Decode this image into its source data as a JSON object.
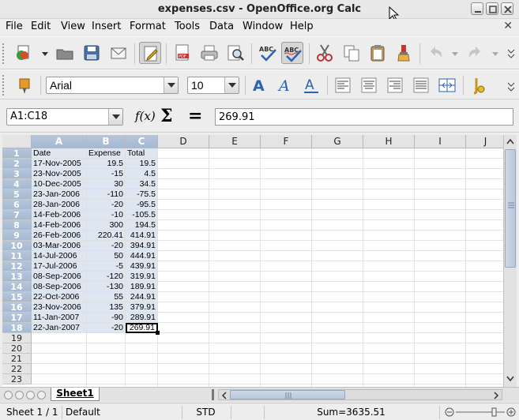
{
  "window": {
    "title": "expenses.csv - OpenOffice.org Calc"
  },
  "menu": [
    "File",
    "Edit",
    "View",
    "Insert",
    "Format",
    "Tools",
    "Data",
    "Window",
    "Help"
  ],
  "toolbar2": {
    "font_name": "Arial",
    "font_size": "10"
  },
  "formula_bar": {
    "name_box": "A1:C18",
    "formula": "269.91",
    "sum_symbol": "Σ",
    "equals_symbol": "="
  },
  "columns": [
    "A",
    "B",
    "C",
    "D",
    "E",
    "F",
    "G",
    "H",
    "I",
    "J"
  ],
  "rows": [
    "1",
    "2",
    "3",
    "4",
    "5",
    "6",
    "7",
    "8",
    "9",
    "10",
    "11",
    "12",
    "13",
    "14",
    "15",
    "16",
    "17",
    "18",
    "19",
    "20",
    "21",
    "22",
    "23"
  ],
  "cells": [
    [
      "Date",
      "Expense",
      "Total"
    ],
    [
      "17-Nov-2005",
      "19.5",
      "19.5"
    ],
    [
      "23-Nov-2005",
      "-15",
      "4.5"
    ],
    [
      "10-Dec-2005",
      "30",
      "34.5"
    ],
    [
      "23-Jan-2006",
      "-110",
      "-75.5"
    ],
    [
      "28-Jan-2006",
      "-20",
      "-95.5"
    ],
    [
      "14-Feb-2006",
      "-10",
      "-105.5"
    ],
    [
      "14-Feb-2006",
      "300",
      "194.5"
    ],
    [
      "26-Feb-2006",
      "220.41",
      "414.91"
    ],
    [
      "03-Mar-2006",
      "-20",
      "394.91"
    ],
    [
      "14-Jul-2006",
      "50",
      "444.91"
    ],
    [
      "17-Jul-2006",
      "-5",
      "439.91"
    ],
    [
      "08-Sep-2006",
      "-120",
      "319.91"
    ],
    [
      "08-Sep-2006",
      "-130",
      "189.91"
    ],
    [
      "22-Oct-2006",
      "55",
      "244.91"
    ],
    [
      "23-Nov-2006",
      "135",
      "379.91"
    ],
    [
      "11-Jan-2007",
      "-90",
      "289.91"
    ],
    [
      "22-Jan-2007",
      "-20",
      "269.91"
    ]
  ],
  "sheet_tab": "Sheet1",
  "status": {
    "sheet": "Sheet 1 / 1",
    "style": "Default",
    "mode": "STD",
    "sum": "Sum=3635.51"
  },
  "colors": {
    "selection": "#dde6f1",
    "header_selected": "#a6b9d2"
  }
}
